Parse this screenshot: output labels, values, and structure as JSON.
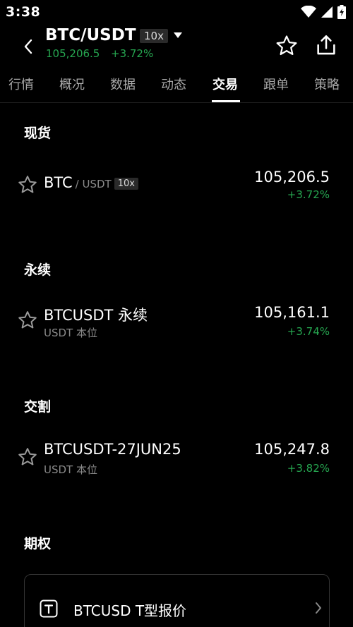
{
  "status": {
    "time": "3:38"
  },
  "header": {
    "pair": "BTC/USDT",
    "leverage": "10x",
    "price": "105,206.5",
    "change": "+3.72%"
  },
  "tabs": [
    {
      "label": "行情"
    },
    {
      "label": "概况"
    },
    {
      "label": "数据"
    },
    {
      "label": "动态"
    },
    {
      "label": "交易"
    },
    {
      "label": "跟单"
    },
    {
      "label": "策略"
    }
  ],
  "sections": {
    "spot": {
      "title": "现货",
      "item": {
        "base": "BTC",
        "quote": "/ USDT",
        "leverage": "10x",
        "price": "105,206.5",
        "change": "+3.72%"
      }
    },
    "perpetual": {
      "title": "永续",
      "item": {
        "name": "BTCUSDT 永续",
        "sub": "USDT 本位",
        "price": "105,161.1",
        "change": "+3.74%"
      }
    },
    "delivery": {
      "title": "交割",
      "item": {
        "name": "BTCUSDT-27JUN25",
        "sub": "USDT 本位",
        "price": "105,247.8",
        "change": "+3.82%"
      }
    },
    "options": {
      "title": "期权",
      "card_label": "BTCUSD T型报价"
    }
  },
  "colors": {
    "up": "#26a650",
    "background": "#000000",
    "muted": "#8a8a8a"
  }
}
